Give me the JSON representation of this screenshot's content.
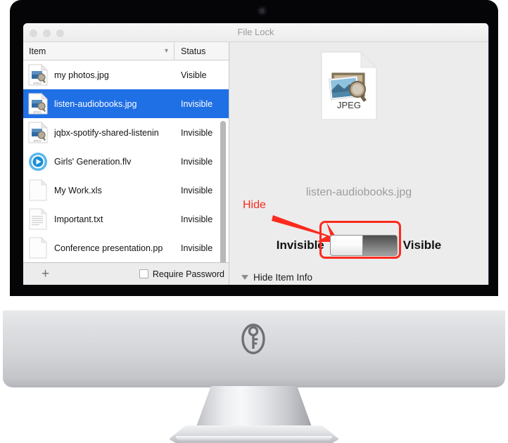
{
  "window": {
    "title": "File Lock",
    "traffic_lights": [
      "close-button",
      "minimize-button",
      "zoom-button"
    ]
  },
  "list": {
    "columns": [
      {
        "label": "Item",
        "sort_icon": "chevron-down-icon"
      },
      {
        "label": "Status"
      }
    ],
    "rows": [
      {
        "name": "my photos.jpg",
        "status": "Visible",
        "icon": "jpeg-file-icon",
        "selected": false
      },
      {
        "name": "listen-audiobooks.jpg",
        "status": "Invisible",
        "icon": "jpeg-file-icon",
        "selected": true
      },
      {
        "name": "jqbx-spotify-shared-listenin",
        "status": "Invisible",
        "icon": "jpeg-file-icon",
        "selected": false
      },
      {
        "name": "Girls' Generation.flv",
        "status": "Invisible",
        "icon": "video-file-icon",
        "selected": false
      },
      {
        "name": "My Work.xls",
        "status": "Invisible",
        "icon": "blank-document-icon",
        "selected": false
      },
      {
        "name": "Important.txt",
        "status": "Invisible",
        "icon": "text-document-icon",
        "selected": false
      },
      {
        "name": "Conference presentation.pp",
        "status": "Invisible",
        "icon": "blank-document-icon",
        "selected": false
      }
    ],
    "footer": {
      "add_label": "+",
      "require_password_label": "Require Password",
      "require_password_checked": false
    }
  },
  "detail": {
    "file_type_badge": "JPEG",
    "file_name": "listen-audiobooks.jpg",
    "toggle": {
      "left_label": "Invisible",
      "right_label": "Visible",
      "state": "visible"
    },
    "disclosure": {
      "label": "Hide Item Info",
      "icon": "disclosure-triangle-down-icon"
    }
  },
  "annotation": {
    "label": "Hide",
    "color": "#fb2b1e",
    "arrow": "red-arrow-icon",
    "highlight": "red-rounded-rectangle"
  },
  "device": {
    "logo": "key-in-oval-logo",
    "webcam": "webcam-dot"
  },
  "colors": {
    "selection_blue": "#1f6fe5",
    "annotation_red": "#fb2b1e",
    "pane_grey": "#ececec",
    "title_grey": "#9a9a9a"
  }
}
